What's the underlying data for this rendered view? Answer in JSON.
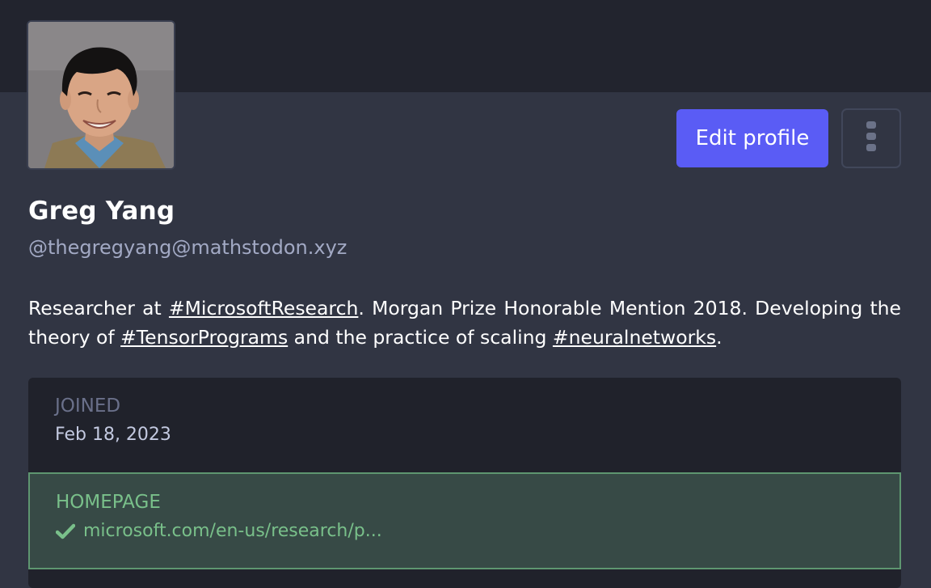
{
  "profile": {
    "display_name": "Greg Yang",
    "handle": "@thegregyang@mathstodon.xyz",
    "bio": {
      "t1": "Researcher at ",
      "tag1": "#MicrosoftResearch",
      "t2": ". Morgan Prize Honorable Mention 2018. Developing the theory of ",
      "tag2": "#TensorPrograms",
      "t3": " and the practice of scaling ",
      "tag3": "#neuralnetworks",
      "t4": "."
    }
  },
  "actions": {
    "edit_label": "Edit profile",
    "more_icon": "vertical-ellipsis-icon"
  },
  "fields": {
    "joined": {
      "label": "JOINED",
      "value": "Feb 18, 2023"
    },
    "homepage": {
      "label": "HOMEPAGE",
      "value": "microsoft.com/en-us/research/p...",
      "icon": "check-icon",
      "verified": true
    }
  },
  "colors": {
    "accent": "#5a5cf5",
    "background": "#313543",
    "header": "#22242e",
    "verified_green": "#79c08a"
  }
}
